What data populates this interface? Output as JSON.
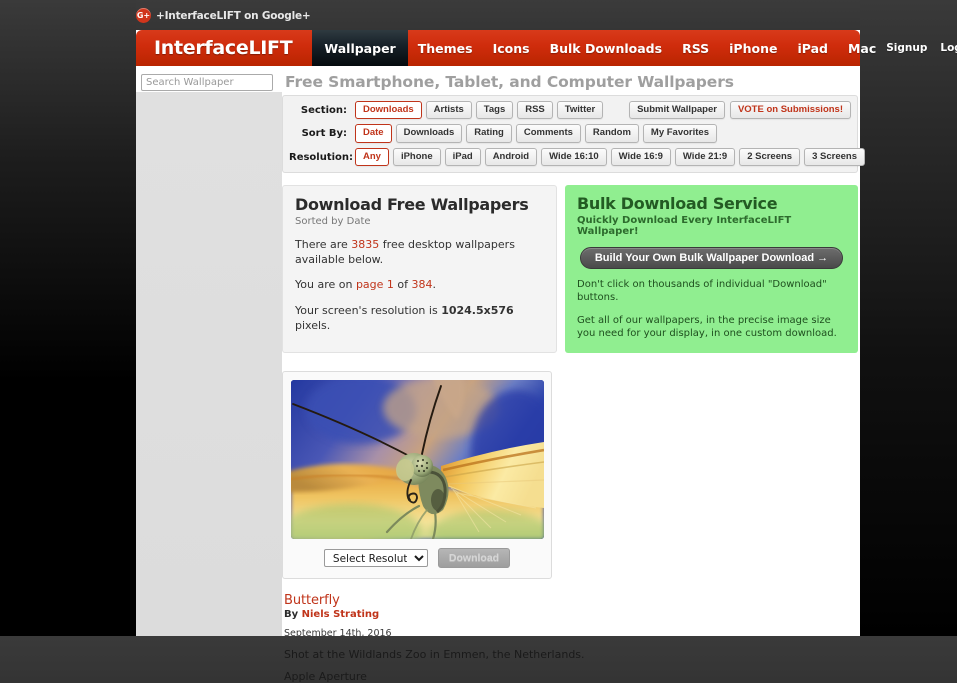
{
  "gplus": {
    "icon": "google-plus-icon",
    "icon_label": "G+",
    "text": "+InterfaceLIFT on Google+"
  },
  "nav": {
    "brand": "InterfaceLIFT",
    "items": [
      {
        "label": "Wallpaper",
        "active": true
      },
      {
        "label": "Themes",
        "active": false
      },
      {
        "label": "Icons",
        "active": false
      },
      {
        "label": "Bulk Downloads",
        "active": false
      },
      {
        "label": "RSS",
        "active": false
      },
      {
        "label": "iPhone",
        "active": false
      },
      {
        "label": "iPad",
        "active": false
      },
      {
        "label": "Mac",
        "active": false
      }
    ],
    "right_items": [
      {
        "label": "Signup"
      },
      {
        "label": "Login"
      }
    ]
  },
  "search": {
    "placeholder": "Search Wallpaper",
    "value": ""
  },
  "page_title": "Free Smartphone, Tablet, and Computer Wallpapers",
  "filters": {
    "section": {
      "label": "Section:",
      "buttons": [
        {
          "label": "Downloads",
          "selected": true
        },
        {
          "label": "Artists",
          "selected": false
        },
        {
          "label": "Tags",
          "selected": false
        },
        {
          "label": "RSS",
          "selected": false
        },
        {
          "label": "Twitter",
          "selected": false
        }
      ],
      "right_buttons": [
        {
          "label": "Submit Wallpaper",
          "red": false
        },
        {
          "label": "VOTE on Submissions!",
          "red": true
        }
      ]
    },
    "sort_by": {
      "label": "Sort By:",
      "buttons": [
        {
          "label": "Date",
          "selected": true
        },
        {
          "label": "Downloads",
          "selected": false
        },
        {
          "label": "Rating",
          "selected": false
        },
        {
          "label": "Comments",
          "selected": false
        },
        {
          "label": "Random",
          "selected": false
        },
        {
          "label": "My Favorites",
          "selected": false
        }
      ]
    },
    "resolution": {
      "label": "Resolution:",
      "buttons": [
        {
          "label": "Any",
          "selected": true
        },
        {
          "label": "iPhone",
          "selected": false
        },
        {
          "label": "iPad",
          "selected": false
        },
        {
          "label": "Android",
          "selected": false
        },
        {
          "label": "Wide 16:10",
          "selected": false
        },
        {
          "label": "Wide 16:9",
          "selected": false
        },
        {
          "label": "Wide 21:9",
          "selected": false
        },
        {
          "label": "2 Screens",
          "selected": false
        },
        {
          "label": "3 Screens",
          "selected": false
        }
      ]
    }
  },
  "download_card": {
    "heading": "Download Free Wallpapers",
    "subheading": "Sorted by Date",
    "count_pre": "There are ",
    "count": "3835",
    "count_post": " free desktop wallpapers available below.",
    "page_pre": "You are on ",
    "page_link": "page 1",
    "page_mid": " of ",
    "page_total": "384",
    "page_post": ".",
    "res_pre": "Your screen's resolution is ",
    "res_value": "1024.5x576",
    "res_post": " pixels."
  },
  "bulk_card": {
    "heading": "Bulk Download Service",
    "subheading": "Quickly Download Every InterfaceLIFT Wallpaper!",
    "button": "Build Your Own Bulk Wallpaper Download →",
    "line1": "Don't click on thousands of individual \"Download\" buttons.",
    "line2": "Get all of our wallpapers, in the precise image size you need for your display, in one custom download.",
    "bg_color": "#90ee90"
  },
  "wallpaper": {
    "image_alt": "Butterfly macro photograph",
    "select_resolution": "Select Resolution:",
    "download_button": "Download",
    "title": "Butterfly",
    "by_prefix": "By ",
    "author": "Niels Strating",
    "date": "September 14th, 2016",
    "description": "Shot at the Wildlands Zoo in Emmen, the Netherlands.",
    "extra": "Apple Aperture"
  },
  "colors": {
    "brand_red": "#c92a0a",
    "accent_red": "#c0341a",
    "bulk_green": "#90ee90",
    "page_bg": "#ffffff",
    "sidebar_gray": "#dedede"
  }
}
